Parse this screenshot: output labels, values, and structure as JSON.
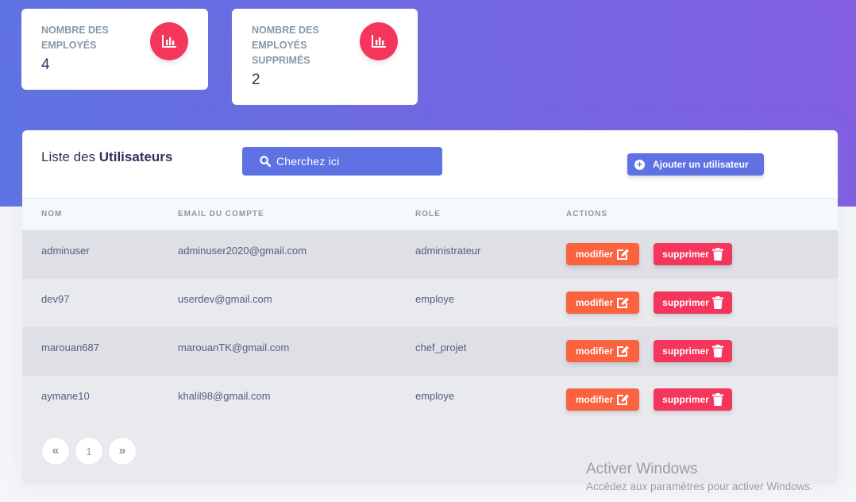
{
  "stats": [
    {
      "label": "NOMBRE DES EMPLOYÉS",
      "value": "4",
      "icon": "chart-bar-icon"
    },
    {
      "label": "NOMBRE DES EMPLOYÉS SUPPRIMÉS",
      "value": "2",
      "icon": "chart-bar-icon"
    }
  ],
  "panel": {
    "title_prefix": "Liste des",
    "title_bold": "Utilisateurs",
    "search_placeholder": "Cherchez ici",
    "add_button_label": "Ajouter un utilisateur"
  },
  "table": {
    "columns": [
      "NOM",
      "EMAIL DU COMPTE",
      "ROLE",
      "ACTIONS"
    ],
    "rows": [
      {
        "nom": "adminuser",
        "email": "adminuser2020@gmail.com",
        "role": "administrateur"
      },
      {
        "nom": "dev97",
        "email": "userdev@gmail.com",
        "role": "employe"
      },
      {
        "nom": "marouan687",
        "email": "marouanTK@gmail.com",
        "role": "chef_projet"
      },
      {
        "nom": "aymane10",
        "email": "khalil98@gmail.com",
        "role": "employe"
      }
    ],
    "edit_label": "modifier",
    "delete_label": "supprimer"
  },
  "pagination": {
    "first": "«",
    "current": "1",
    "last": "»"
  },
  "watermark": {
    "title": "Activer Windows",
    "subtitle": "Accédez aux paramètres pour activer Windows."
  },
  "colors": {
    "primary": "#5e72e4",
    "danger": "#f5365c",
    "warning": "#fb6340"
  }
}
